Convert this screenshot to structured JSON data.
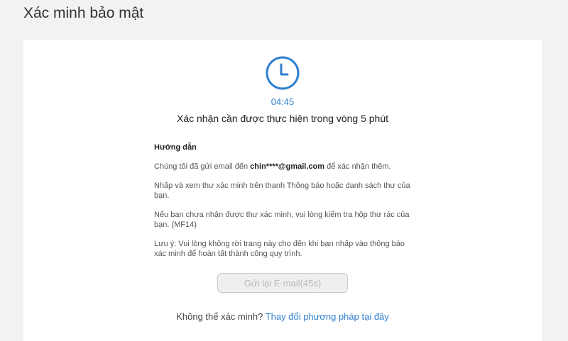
{
  "header": {
    "title": "Xác minh bảo mật"
  },
  "verification": {
    "icon": "clock-icon",
    "timer": "04:45",
    "subtitle": "Xác nhận cần được thực hiện trong vòng 5 phút"
  },
  "guide": {
    "heading": "Hướng dẫn",
    "line1_prefix": "Chúng tôi đã gửi email đến ",
    "line1_email": "chin****@gmail.com",
    "line1_suffix": " để xác nhận thêm.",
    "line2": "Nhấp và xem thư xác minh trên thanh Thông báo hoặc danh sách thư của bạn.",
    "line3": "Nếu bạn chưa nhận được thư xác minh, vui lòng kiểm tra hộp thư rác của bạn. (MF14)",
    "line4": "Lưu ý: Vui lòng không rời trang này cho đến khi bạn nhấp vào thông báo xác minh để hoàn tất thành công quy trình."
  },
  "resend": {
    "label": "Gửi lại E-mail(45s)",
    "enabled": false
  },
  "alternative": {
    "prompt": "Không thể xác minh? ",
    "link_label": "Thay đổi phương pháp tại đây"
  },
  "colors": {
    "accent": "#2f7fd0",
    "background": "#f2f2f2",
    "card": "#ffffff"
  }
}
